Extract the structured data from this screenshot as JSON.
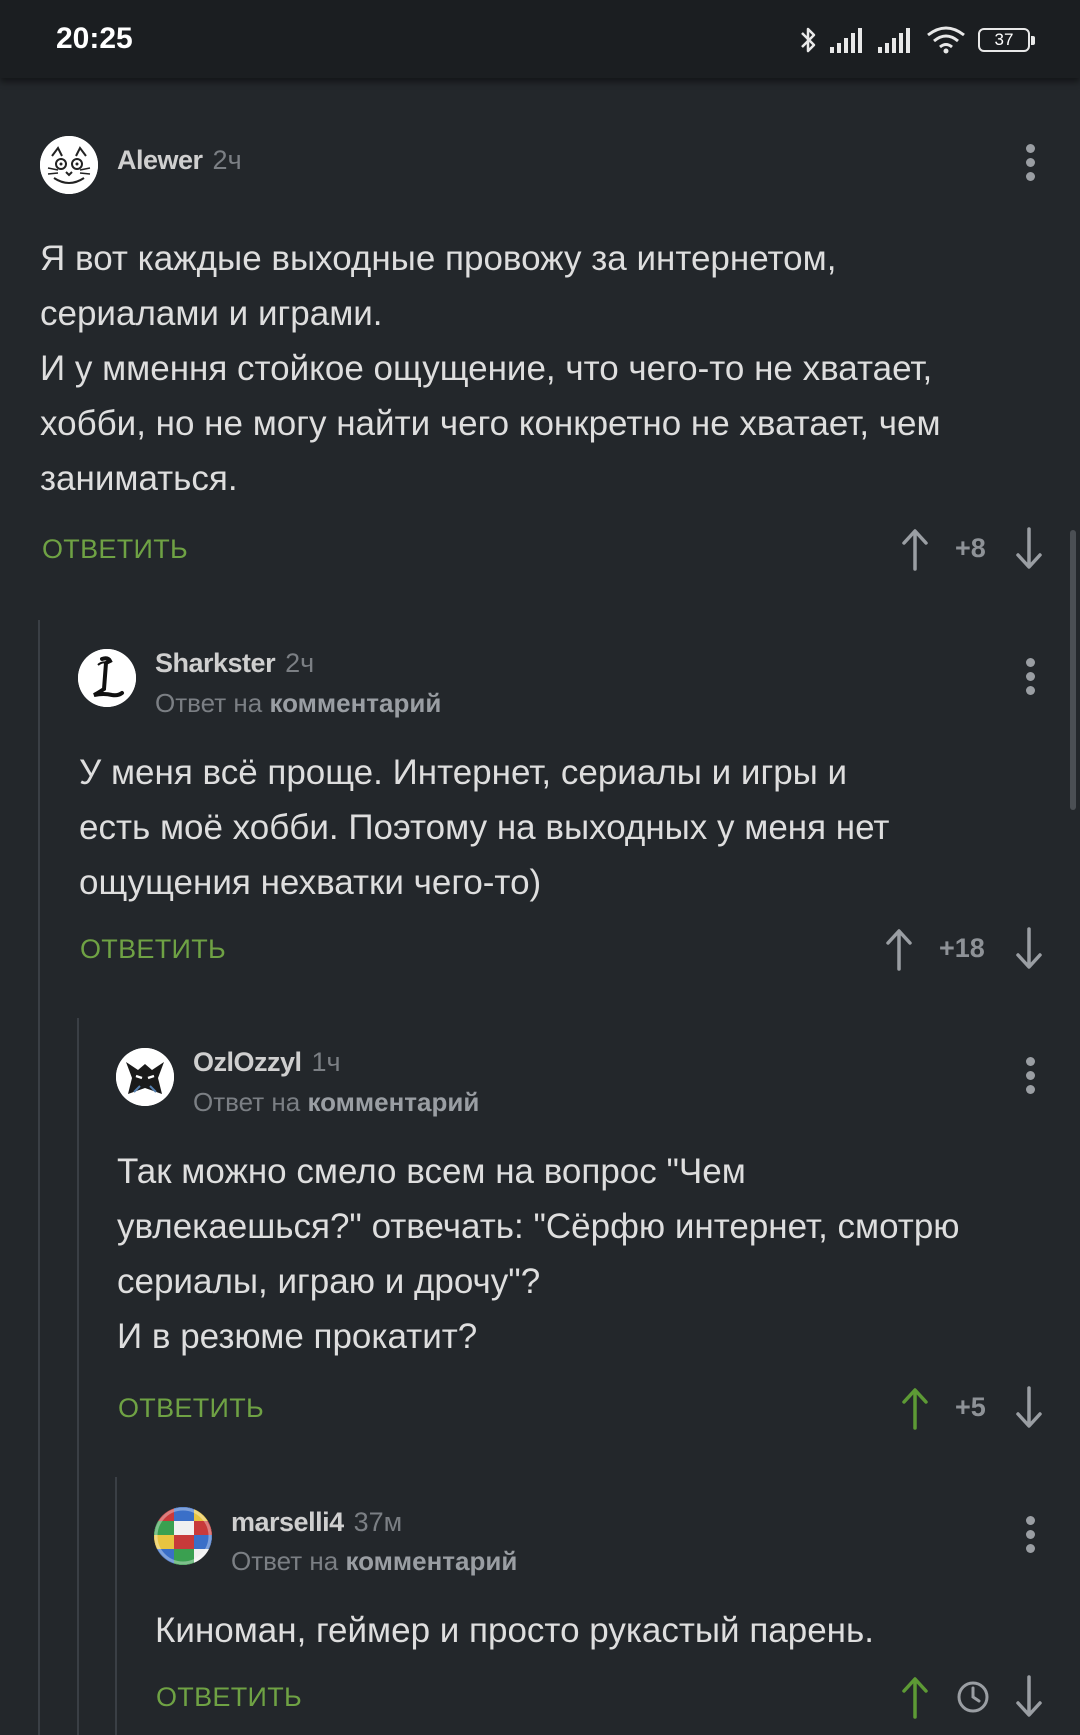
{
  "status_bar": {
    "time": "20:25",
    "battery": "37"
  },
  "colors": {
    "background": "#23272b",
    "reply_green": "#6fa244",
    "upvoted_green": "#5d9a35",
    "muted": "#7b7f84"
  },
  "comments": [
    {
      "author": "Alewer",
      "time": "2ч",
      "avatar_icon": "cat-sketch-avatar",
      "lines": [
        "Я вот каждые выходные провожу за интернетом,",
        "сериалами и играми.",
        "И у ммення стойкое ощущение, что чего-то не хватает,",
        "хобби, но не могу найти чего конкретно не хватает, чем",
        "заниматься."
      ],
      "reply_label": "ОТВЕТИТЬ",
      "score": "+8"
    },
    {
      "author": "Sharkster",
      "time": "2ч",
      "avatar_icon": "gothic-L-avatar",
      "reply_to_prefix": "Ответ на",
      "reply_to_link": "комментарий",
      "lines": [
        "У меня всё проще. Интернет, сериалы и игры и",
        "есть моё хобби. Поэтому на выходных у меня нет",
        "ощущения нехватки чего-то)"
      ],
      "reply_label": "ОТВЕТИТЬ",
      "score": "+18"
    },
    {
      "author": "OzlOzzyl",
      "time": "1ч",
      "avatar_icon": "ninja-avatar",
      "reply_to_prefix": "Ответ на",
      "reply_to_link": "комментарий",
      "lines": [
        "Так можно смело всем на вопрос \"Чем",
        "увлекаешься?\" отвечать: \"Сёрфю интернет, смотрю",
        "сериалы, играю и дрочу\"?",
        "И в резюме прокатит?"
      ],
      "reply_label": "ОТВЕТИТЬ",
      "score": "+5"
    },
    {
      "author": "marselli4",
      "time": "37м",
      "avatar_icon": "flags-globe-avatar",
      "reply_to_prefix": "Ответ на",
      "reply_to_link": "комментарий",
      "lines": [
        "Киноман, геймер и просто рукастый парень."
      ],
      "reply_label": "ОТВЕТИТЬ"
    }
  ]
}
